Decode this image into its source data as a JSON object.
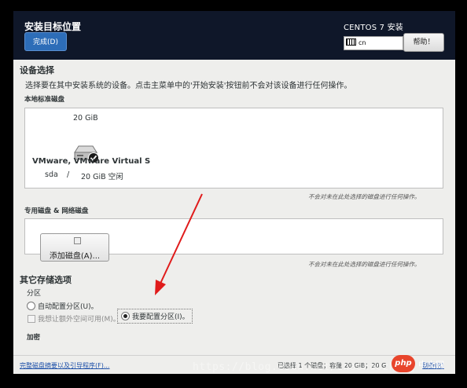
{
  "header": {
    "title": "安装目标位置",
    "done_label": "完成(D)",
    "os_title": "CENTOS 7 安装",
    "keyboard_layout": "cn",
    "help_label": "帮助！"
  },
  "device_selection": {
    "heading": "设备选择",
    "instructions": "选择要在其中安装系统的设备。点击主菜单中的'开始安装'按钮前不会对该设备进行任何操作。",
    "local_disks_label": "本地标准磁盘",
    "disk": {
      "size": "20 GiB",
      "name": "VMware, VMware Virtual S",
      "device": "sda",
      "separator": "/",
      "free": "20 GiB 空闲"
    },
    "local_note": "不会对未在此处选择的磁盘进行任何操作。",
    "special_disks_label": "专用磁盘 & 网络磁盘",
    "add_disk_label": "添加磁盘(A)...",
    "special_note": "不会对未在此处选择的磁盘进行任何操作。"
  },
  "other_options": {
    "heading": "其它存储选项",
    "partitioning_label": "分区",
    "auto_label": "自动配置分区(U)。",
    "manual_label": "我要配置分区(I)。",
    "extra_space_label": "我想让额外空间可用(M)。",
    "encryption_label": "加密"
  },
  "footer": {
    "summary_link": "完整磁盘摘要以及引导程序(F)...",
    "status": "已选择 1 个磁盘；容量 20 GiB；20 G",
    "reset_link": "刷新(R)"
  },
  "overlay": {
    "watermark": "https://blog.csdn.net/Chashaozhang",
    "logo": "php",
    "logo_text": "中文网"
  },
  "colors": {
    "header_bg": "#0f1729",
    "accent": "#2d6db8",
    "arrow": "#e01b1b"
  }
}
